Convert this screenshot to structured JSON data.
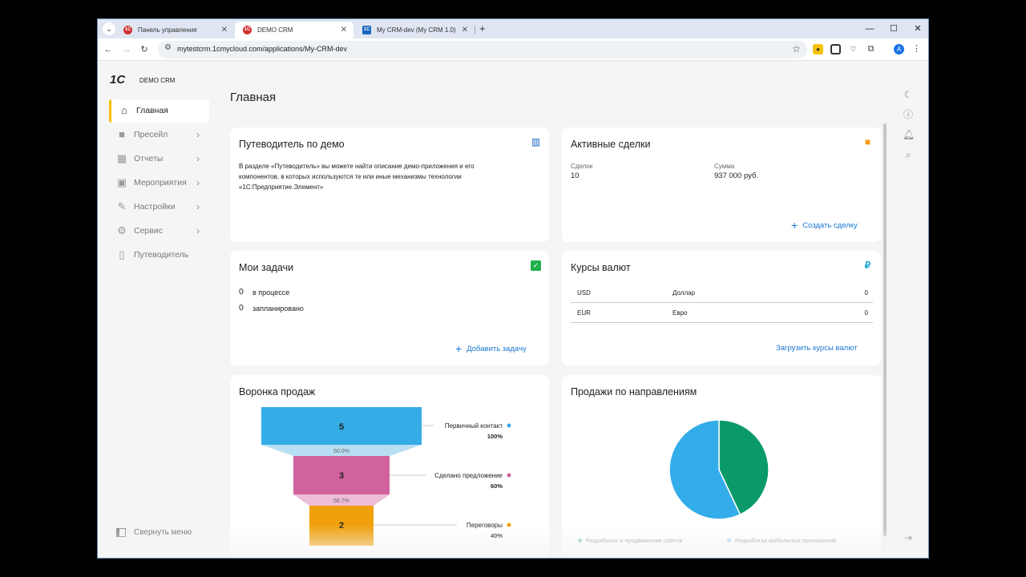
{
  "browser": {
    "tabs": [
      {
        "title": "Панель управления",
        "favicon": "1c-icon",
        "active": false
      },
      {
        "title": "DEMO CRM",
        "favicon": "1c-icon",
        "active": true
      },
      {
        "title": "My CRM-dev (My CRM 1.0)",
        "favicon": "app-icon",
        "active": false
      }
    ],
    "url": "mytestcrm.1cmycloud.com/applications/My-CRM-dev",
    "profile_initial": "A"
  },
  "app": {
    "logo": "1С",
    "name": "DEMO CRM",
    "page_title": "Главная",
    "sidebar": [
      {
        "label": "Главная",
        "icon": "home-icon",
        "active": true,
        "has_children": false
      },
      {
        "label": "Пресейл",
        "icon": "briefcase-icon",
        "active": false,
        "has_children": true
      },
      {
        "label": "Отчеты",
        "icon": "dashboard-icon",
        "active": false,
        "has_children": true
      },
      {
        "label": "Мероприятия",
        "icon": "calendar-icon",
        "active": false,
        "has_children": true
      },
      {
        "label": "Настройки",
        "icon": "edit-icon",
        "active": false,
        "has_children": true
      },
      {
        "label": "Сервис",
        "icon": "gear-icon",
        "active": false,
        "has_children": true
      },
      {
        "label": "Путеводитель",
        "icon": "book-icon",
        "active": false,
        "has_children": false
      }
    ],
    "collapse_label": "Свернуть меню"
  },
  "cards": {
    "guide": {
      "title": "Путеводитель по демо",
      "text": "В разделе «Путеводитель» вы можете найти описание демо-приложения и его компонентов, в которых используются те или иные механизмы технологии «1С:Предприятие.Элемент»"
    },
    "deals": {
      "title": "Активные сделки",
      "count_label": "Сделок",
      "count_value": "10",
      "sum_label": "Сумма",
      "sum_value": "937 000 руб.",
      "action": "Создать сделку"
    },
    "tasks": {
      "title": "Мои задачи",
      "rows": [
        {
          "count": "0",
          "label": "в процессе"
        },
        {
          "count": "0",
          "label": "запланировано"
        }
      ],
      "action": "Добавить задачу"
    },
    "rates": {
      "title": "Курсы валют",
      "rows": [
        {
          "code": "USD",
          "name": "Доллар",
          "value": "0"
        },
        {
          "code": "EUR",
          "name": "Евро",
          "value": "0"
        }
      ],
      "action": "Загрузить курсы валют"
    },
    "funnel": {
      "title": "Воронка продаж",
      "stages": [
        {
          "value": "5",
          "label": "Первичный контакт",
          "pct": "100%",
          "color": "#35ace6",
          "conv": "60.0%"
        },
        {
          "value": "3",
          "label": "Сделано предложение",
          "pct": "60%",
          "color": "#d0639e",
          "conv": "66.7%"
        },
        {
          "value": "2",
          "label": "Переговоры",
          "pct": "40%",
          "color": "#f0a00a",
          "conv": ""
        }
      ]
    },
    "sales": {
      "title": "Продажи по направлениям"
    }
  },
  "chart_data": {
    "type": "pie",
    "title": "Продажи по направлениям",
    "categories": [
      "Разработка и продвижение сайтов",
      "Разработка мобильных приложений"
    ],
    "values": [
      43,
      57
    ],
    "colors": [
      "#0a9a6a",
      "#33adea"
    ]
  }
}
